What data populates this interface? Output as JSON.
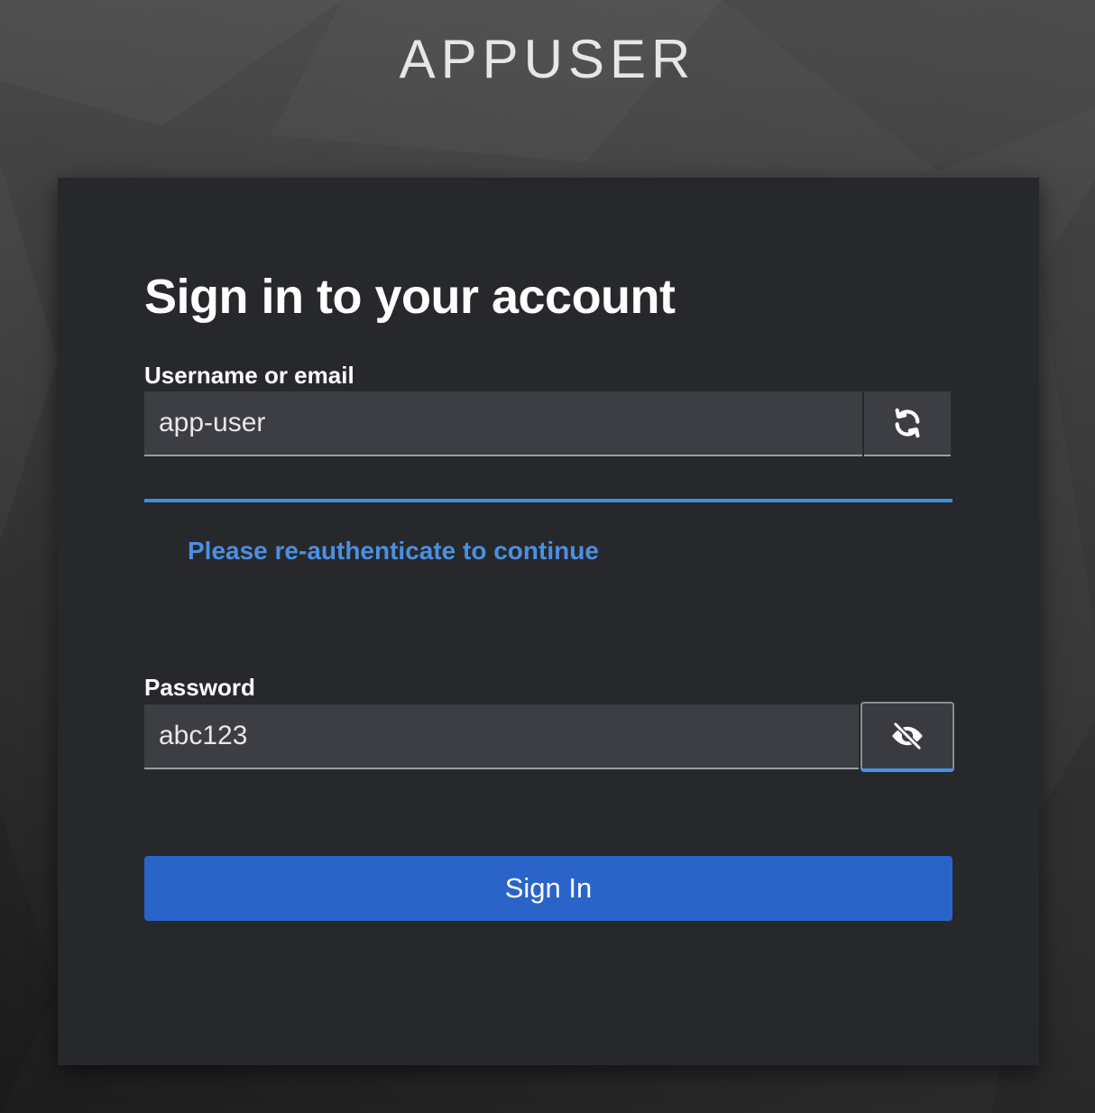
{
  "brand": {
    "name": "APPUSER"
  },
  "login": {
    "title": "Sign in to your account",
    "username": {
      "label": "Username or email",
      "value": "app-user",
      "restart_icon": "refresh-icon"
    },
    "info_message": "Please re-authenticate to continue",
    "password": {
      "label": "Password",
      "value": "abc123",
      "toggle_icon": "eye-slash-icon"
    },
    "submit_label": "Sign In"
  },
  "colors": {
    "card_background": "#27282c",
    "accent_blue": "#2b64c8",
    "link_blue": "#4a90e2",
    "input_background": "#3d3e43"
  }
}
